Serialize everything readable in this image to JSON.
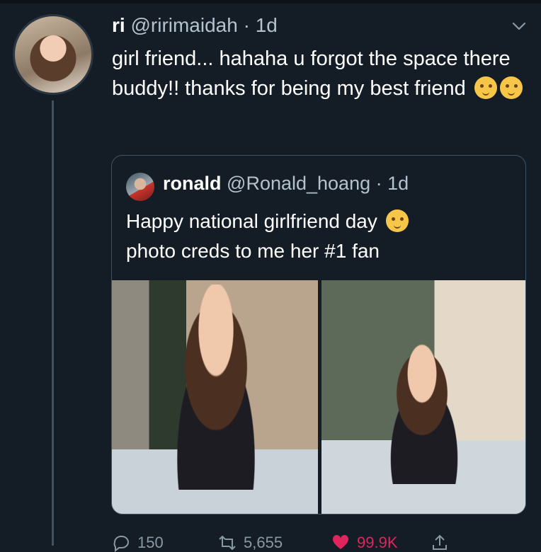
{
  "tweet": {
    "display_name": "ri",
    "handle": "@ririmaidah",
    "separator": "·",
    "time": "1d",
    "text": "girl friend... hahaha u forgot the space there buddy!! thanks for being my best friend",
    "emojis": [
      "kissing-face-emoji",
      "relieved-face-emoji"
    ]
  },
  "quoted_tweet": {
    "display_name": "ronald",
    "handle": "@Ronald_hoang",
    "separator": "·",
    "time": "1d",
    "line1": "Happy national girlfriend day",
    "line2": "photo creds to me her #1 fan",
    "emoji": "smiling-face-with-hearts-emoji",
    "photos": [
      "photo-woman-seated-at-table",
      "photo-woman-leaning-on-table"
    ]
  },
  "actions": {
    "reply_count": "150",
    "retweet_count": "5,655",
    "like_count": "99.9K"
  },
  "colors": {
    "background": "#141d26",
    "secondary_text": "#b3c2cf",
    "border": "#3d5466",
    "like": "#e0245e"
  }
}
